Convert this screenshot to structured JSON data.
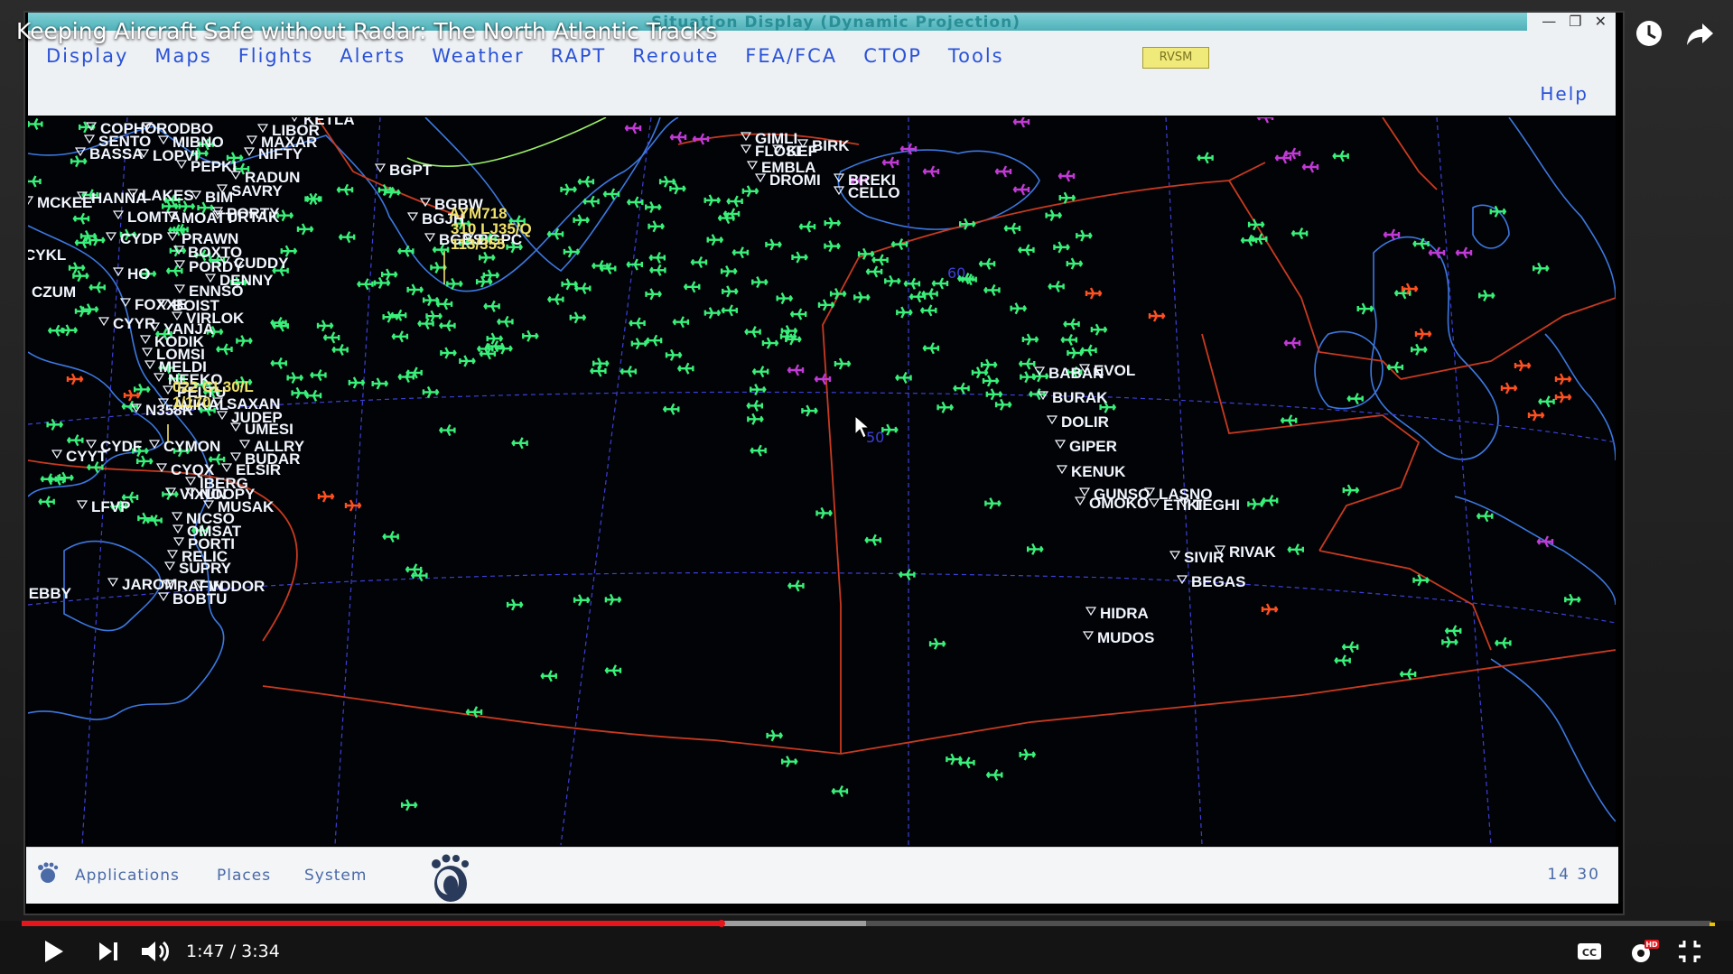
{
  "video": {
    "title": "Keeping Aircraft Safe without Radar: The North Atlantic Tracks",
    "time_current": "1:47",
    "time_total": "3:34",
    "time_display": "1:47 / 3:34",
    "progress_fraction": 0.4999,
    "buffer_fraction": 0.414,
    "hd_badge": "HD"
  },
  "window": {
    "title_partial": "Situation Display (Dynamic Projection)"
  },
  "menu": {
    "items": [
      "Display",
      "Maps",
      "Flights",
      "Alerts",
      "Weather",
      "RAPT",
      "Reroute",
      "FEA/FCA",
      "CTOP",
      "Tools"
    ],
    "rvsm": "RVSM",
    "help": "Help"
  },
  "taskbar": {
    "applications": "Applications",
    "places": "Places",
    "system": "System",
    "clock": "14 30"
  },
  "colors": {
    "flight_green": "#39f07a",
    "flight_magenta": "#c23ad6",
    "flight_orange": "#ff5020",
    "boundary_red": "#c83a20",
    "label_white": "#f2f6ff",
    "datablock_yellow": "#f0e26a",
    "grid_blue": "#3c40d8",
    "coast_blue": "#3c78e0",
    "progress_red": "#e5171d"
  },
  "icons": [
    "watch-later-icon",
    "share-icon",
    "play-icon",
    "next-icon",
    "volume-icon",
    "captions-icon",
    "settings-icon",
    "exit-fullscreen-icon",
    "gnome-foot-icon",
    "minimize-icon",
    "maximize-icon",
    "close-icon"
  ],
  "waypoints": [
    {
      "name": "COPHO"
    },
    {
      "name": "RODBO"
    },
    {
      "name": "SENTO"
    },
    {
      "name": "MIBNO"
    },
    {
      "name": "BASSA"
    },
    {
      "name": "LOPVI"
    },
    {
      "name": "PEPKI"
    },
    {
      "name": "NIFTY"
    },
    {
      "name": "LIBOR"
    },
    {
      "name": "MAXAR"
    },
    {
      "name": "KETLA"
    },
    {
      "name": "RADUN"
    },
    {
      "name": "SAVRY"
    },
    {
      "name": "HANNA"
    },
    {
      "name": "LAKES"
    },
    {
      "name": "BIM"
    },
    {
      "name": "PORTY"
    },
    {
      "name": "MCKEE"
    },
    {
      "name": "LOMTA"
    },
    {
      "name": "MOATT"
    },
    {
      "name": "URTAK"
    },
    {
      "name": "CYDP"
    },
    {
      "name": "PRAWN"
    },
    {
      "name": "BOXTO"
    },
    {
      "name": "CUDDY"
    },
    {
      "name": "HO"
    },
    {
      "name": "PORDY"
    },
    {
      "name": "DENNY"
    },
    {
      "name": "CZUM"
    },
    {
      "name": "ENNSO"
    },
    {
      "name": "FOXXE"
    },
    {
      "name": "BOIST"
    },
    {
      "name": "VIRLOK"
    },
    {
      "name": "CYYR"
    },
    {
      "name": "YANJA"
    },
    {
      "name": "KODIK"
    },
    {
      "name": "LOMSI"
    },
    {
      "name": "MELDI"
    },
    {
      "name": "NEEKO"
    },
    {
      "name": "PELTU"
    },
    {
      "name": "AVIKAL"
    },
    {
      "name": "SAXAN"
    },
    {
      "name": "N358R"
    },
    {
      "name": "JUDEP"
    },
    {
      "name": "UMESI"
    },
    {
      "name": "CYDF"
    },
    {
      "name": "CYMON"
    },
    {
      "name": "ALLRY"
    },
    {
      "name": "BUDAR"
    },
    {
      "name": "CYQX"
    },
    {
      "name": "ELSIR"
    },
    {
      "name": "IBERG"
    },
    {
      "name": "VIXUN"
    },
    {
      "name": "NOOPY"
    },
    {
      "name": "MUSAK"
    },
    {
      "name": "LFVP"
    },
    {
      "name": "CYYT"
    },
    {
      "name": "NICSO"
    },
    {
      "name": "OMSAT"
    },
    {
      "name": "PORTI"
    },
    {
      "name": "RELIC"
    },
    {
      "name": "SUPRY"
    },
    {
      "name": "JAROM"
    },
    {
      "name": "RAFIN"
    },
    {
      "name": "VODOR"
    },
    {
      "name": "BOBTU"
    },
    {
      "name": "IEBBY"
    },
    {
      "name": "BGPT"
    },
    {
      "name": "BGBW"
    },
    {
      "name": "BGJH"
    },
    {
      "name": "BGBS"
    },
    {
      "name": "BGPC"
    },
    {
      "name": "GIMLI"
    },
    {
      "name": "FLOSI"
    },
    {
      "name": "KEF"
    },
    {
      "name": "BIRK"
    },
    {
      "name": "EMBLA"
    },
    {
      "name": "DROMI"
    },
    {
      "name": "BREKI"
    },
    {
      "name": "CELLO"
    },
    {
      "name": "BABAN"
    },
    {
      "name": "EVOL"
    },
    {
      "name": "BURAK"
    },
    {
      "name": "DOLIR"
    },
    {
      "name": "GIPER"
    },
    {
      "name": "KENUK"
    },
    {
      "name": "GUNSO"
    },
    {
      "name": "LASNO"
    },
    {
      "name": "OMOKO"
    },
    {
      "name": "ETIKI"
    },
    {
      "name": "TEGHI"
    },
    {
      "name": "SIVIR"
    },
    {
      "name": "RIVAK"
    },
    {
      "name": "BEGAS"
    },
    {
      "name": "HIDRA"
    },
    {
      "name": "MUDOS"
    },
    {
      "name": "CYKL"
    }
  ],
  "datablocks": [
    {
      "lines": [
        "AYM718",
        "310 LJ35/Q",
        "113/355"
      ]
    },
    {
      "lines": [
        "022 CL30/L",
        "1/170"
      ]
    }
  ],
  "grid_labels": [
    {
      "text": "60"
    },
    {
      "text": "50"
    }
  ],
  "flights": {
    "green_count": 300,
    "magenta_count": 22,
    "orange_count": 14
  }
}
